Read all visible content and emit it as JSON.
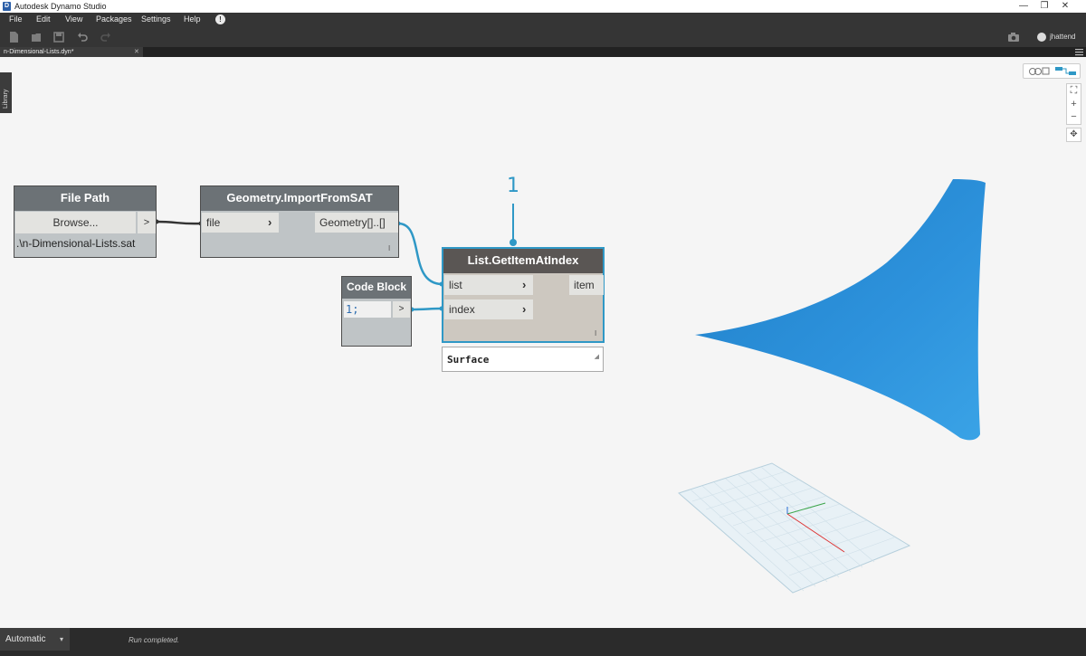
{
  "window": {
    "app_icon": "D",
    "title": "Autodesk Dynamo Studio",
    "controls": [
      "—",
      "❐",
      "✕"
    ]
  },
  "menu": {
    "items": [
      "File",
      "Edit",
      "View",
      "Packages",
      "Settings",
      "Help"
    ],
    "alert_icon": "!"
  },
  "toolbar": {
    "icons": [
      "new-file-icon",
      "open-file-icon",
      "save-icon",
      "undo-icon",
      "redo-icon"
    ],
    "camera_icon": "camera-icon",
    "user": "jhattend"
  },
  "tab": {
    "label": "n-Dimensional-Lists.dyn*",
    "close": "✕"
  },
  "library": {
    "label": "Library"
  },
  "view_controls": {
    "zoom_fit": "⛶",
    "zoom_in": "+",
    "zoom_out": "−",
    "pan": "✥"
  },
  "nodes": {
    "file_path": {
      "title": "File Path",
      "button": "Browse...",
      "output": ">",
      "path": ".\\n-Dimensional-Lists.sat"
    },
    "import_sat": {
      "title": "Geometry.ImportFromSAT",
      "input": "file",
      "output": "Geometry[]..[]",
      "lacing": "I"
    },
    "code_block": {
      "title": "Code Block",
      "code": "1;",
      "output": ">"
    },
    "get_item": {
      "title": "List.GetItemAtIndex",
      "inputs": [
        "list",
        "index"
      ],
      "output": "item",
      "lacing": "I"
    }
  },
  "preview": {
    "value": "Surface"
  },
  "callout": "1",
  "status": {
    "run_mode": "Automatic",
    "message": "Run completed."
  },
  "colors": {
    "accent": "#2f98c6",
    "surface": "#2d8fd5",
    "node_header": "#6c7276",
    "chrome": "#353535"
  }
}
